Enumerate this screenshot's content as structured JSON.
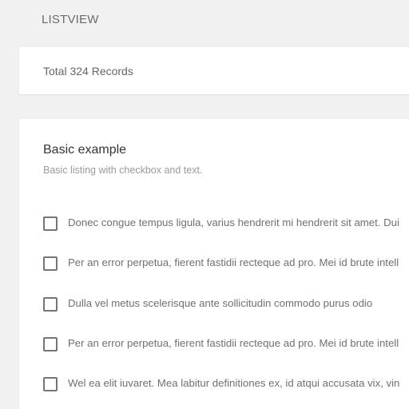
{
  "page": {
    "title": "LISTVIEW"
  },
  "summary": {
    "text": "Total 324 Records"
  },
  "list_card": {
    "title": "Basic example",
    "subtitle": "Basic listing with checkbox and text.",
    "items": [
      {
        "text": "Donec congue tempus ligula, varius hendrerit mi hendrerit sit amet. Dui",
        "checked": false
      },
      {
        "text": "Per an error perpetua, fierent fastidii recteque ad pro. Mei id brute intell",
        "checked": false
      },
      {
        "text": "Dulla vel metus scelerisque ante sollicitudin commodo purus odio",
        "checked": false
      },
      {
        "text": "Per an error perpetua, fierent fastidii recteque ad pro. Mei id brute intell",
        "checked": false
      },
      {
        "text": "Wel ea elit iuvaret. Mea labitur definitiones ex, id atqui accusata vix, vin",
        "checked": false
      }
    ]
  },
  "colors": {
    "background": "#f1f1f1",
    "card": "#ffffff",
    "checkbox_border": "#757575"
  }
}
